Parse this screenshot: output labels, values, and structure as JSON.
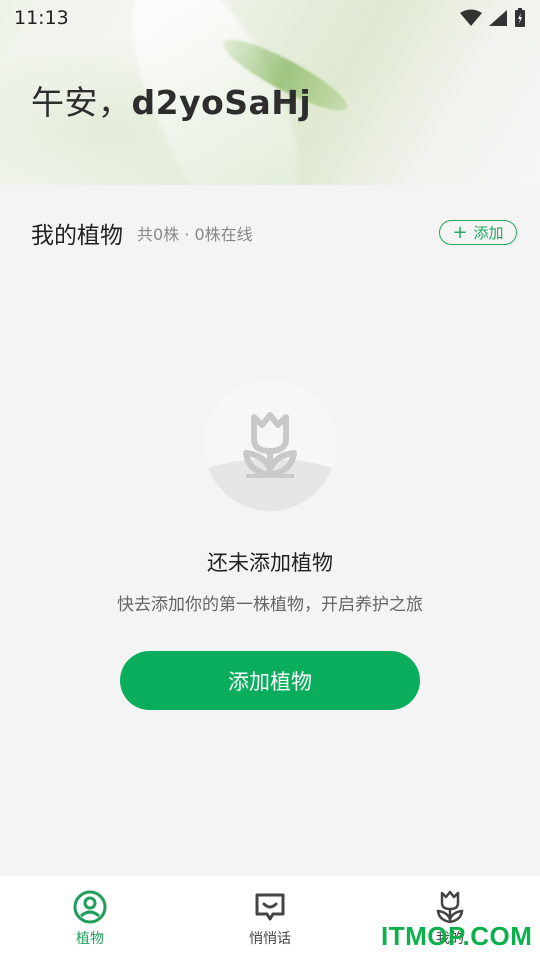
{
  "status_bar": {
    "time": "11:13"
  },
  "header": {
    "greeting_prefix": "午安，",
    "username": "d2yoSaHj"
  },
  "plants_section": {
    "title": "我的植物",
    "subtitle": "共0株 · 0株在线",
    "add_label": "添加"
  },
  "empty_state": {
    "icon": "tulip-icon",
    "title": "还未添加植物",
    "description": "快去添加你的第一株植物，开启养护之旅",
    "button_label": "添加植物"
  },
  "bottom_nav": {
    "items": [
      {
        "label": "植物",
        "icon": "user-circle-icon",
        "active": true
      },
      {
        "label": "悄悄话",
        "icon": "chat-bubble-icon",
        "active": false
      },
      {
        "label": "我的",
        "icon": "tulip-icon",
        "active": false
      }
    ]
  },
  "watermark": "ITMOP.COM",
  "colors": {
    "accent": "#0aad5c",
    "active_nav": "#1f9e5a"
  }
}
